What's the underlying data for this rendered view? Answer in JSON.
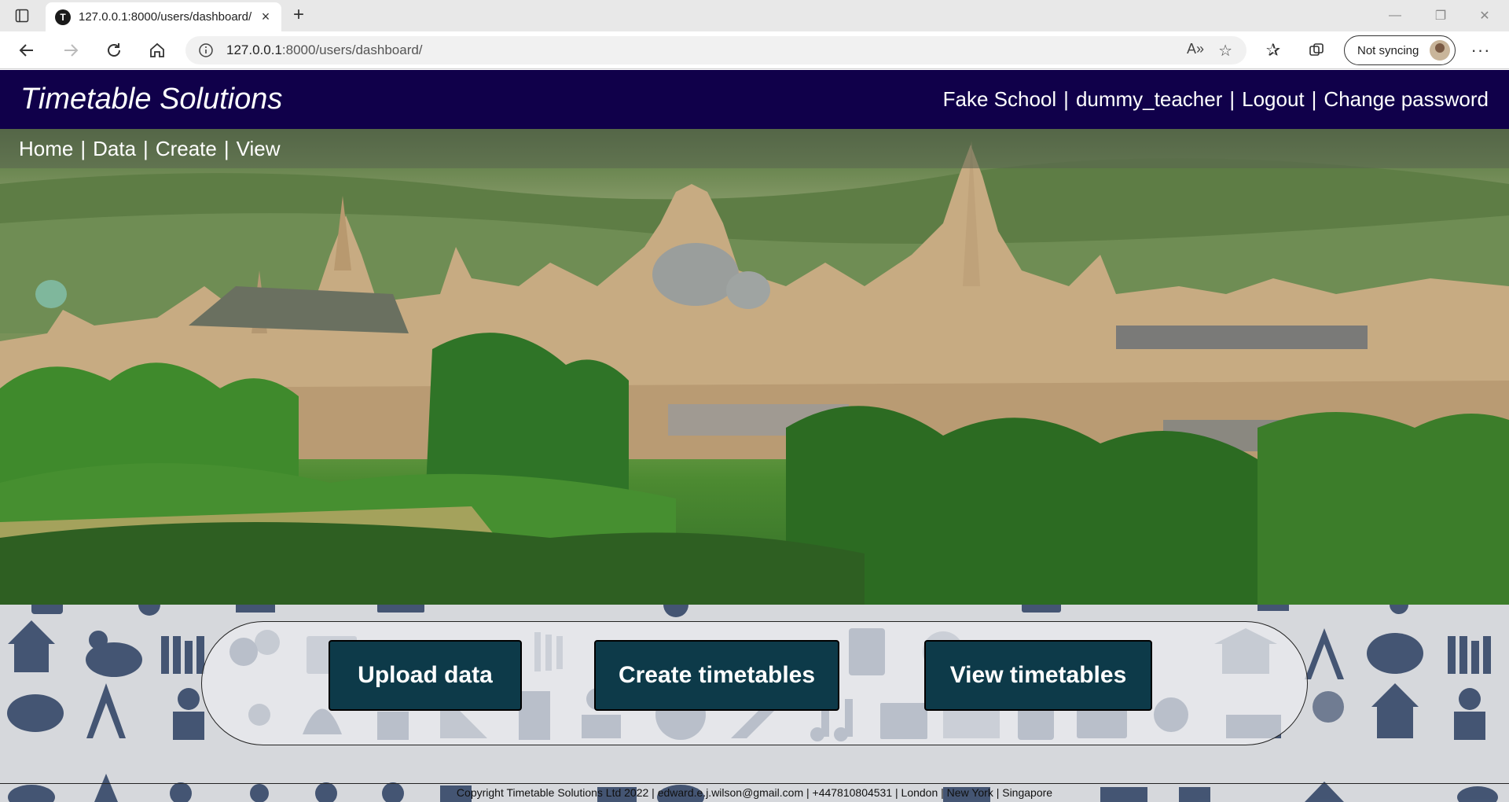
{
  "browser": {
    "tab_title": "127.0.0.1:8000/users/dashboard/",
    "favicon_letter": "T",
    "url_host": "127.0.0.1",
    "url_rest": ":8000/users/dashboard/",
    "sync_label": "Not syncing"
  },
  "header": {
    "site_title": "Timetable Solutions",
    "school": "Fake School",
    "username": "dummy_teacher",
    "logout": "Logout",
    "change_password": "Change password",
    "separator": "|"
  },
  "nav": {
    "items": [
      "Home",
      "Data",
      "Create",
      "View"
    ],
    "separator": "|"
  },
  "actions": {
    "upload": "Upload data",
    "create": "Create timetables",
    "view": "View timetables"
  },
  "footer": {
    "text": "Copyright Timetable Solutions Ltd 2022 | edward.e.j.wilson@gmail.com | +447810804531 | London | New York | Singapore"
  },
  "colors": {
    "header_bg": "#10004a",
    "button_bg": "#0d3a49",
    "pattern_bg": "#d6d8dc",
    "icon_color": "#3d4f6e"
  }
}
